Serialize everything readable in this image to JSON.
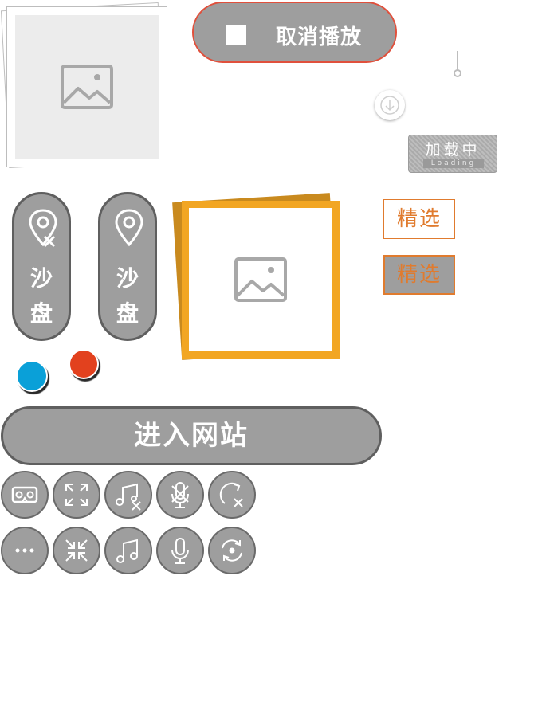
{
  "cancel_play": {
    "label": "取消播放"
  },
  "loading": {
    "label_cn": "加载中",
    "label_en": "Loading"
  },
  "sand_table": [
    {
      "line1": "沙",
      "line2": "盘",
      "icon": "location-off-icon"
    },
    {
      "line1": "沙",
      "line2": "盘",
      "icon": "location-icon"
    }
  ],
  "featured": [
    {
      "label": "精选",
      "state": "normal"
    },
    {
      "label": "精选",
      "state": "selected"
    }
  ],
  "enter_site": {
    "label": "进入网站"
  },
  "colors": {
    "accent_orange": "#f2a623",
    "border_red": "#e0503c",
    "chip_orange": "#e07b2e",
    "dot_blue": "#0aa0d8",
    "dot_red": "#e2411e",
    "button_gray": "#9e9e9e"
  },
  "icon_buttons_row1": [
    "vr-icon",
    "fullscreen-icon",
    "music-off-icon",
    "mic-off-icon",
    "rotate-off-icon"
  ],
  "icon_buttons_row2": [
    "more-icon",
    "exit-fullscreen-icon",
    "music-icon",
    "mic-icon",
    "rotate-icon"
  ]
}
